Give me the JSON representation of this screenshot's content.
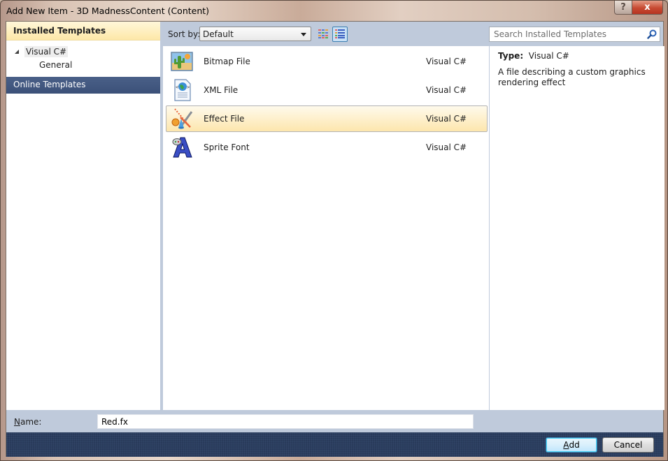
{
  "window": {
    "title": "Add New Item - 3D MadnessContent (Content)",
    "help_label": "?",
    "close_label": "x"
  },
  "left_panel": {
    "installed_header": "Installed Templates",
    "tree": [
      {
        "label": "Visual C#",
        "expanded": true,
        "selected": true
      },
      {
        "label": "General",
        "expanded": false,
        "selected": false
      }
    ],
    "online_header": "Online Templates"
  },
  "toolbar": {
    "sort_label": "Sort by:",
    "sort_value": "Default",
    "view_modes": [
      {
        "icon": "medium-icons-view-icon",
        "active": false
      },
      {
        "icon": "small-icons-view-icon",
        "active": true
      }
    ]
  },
  "templates": [
    {
      "name": "Bitmap File",
      "language": "Visual C#",
      "icon": "bitmap-file-icon",
      "selected": false
    },
    {
      "name": "XML File",
      "language": "Visual C#",
      "icon": "xml-file-icon",
      "selected": false
    },
    {
      "name": "Effect File",
      "language": "Visual C#",
      "icon": "effect-file-icon",
      "selected": true
    },
    {
      "name": "Sprite Font",
      "language": "Visual C#",
      "icon": "sprite-font-icon",
      "selected": false
    }
  ],
  "search": {
    "placeholder": "Search Installed Templates",
    "value": ""
  },
  "details": {
    "type_label": "Type:",
    "type_value": "Visual C#",
    "description": "A file describing a custom graphics rendering effect"
  },
  "name_field": {
    "label_access_key": "N",
    "label_rest": "ame:",
    "value": "Red.fx"
  },
  "buttons": {
    "add_access_key": "A",
    "add_rest": "dd",
    "cancel": "Cancel"
  }
}
